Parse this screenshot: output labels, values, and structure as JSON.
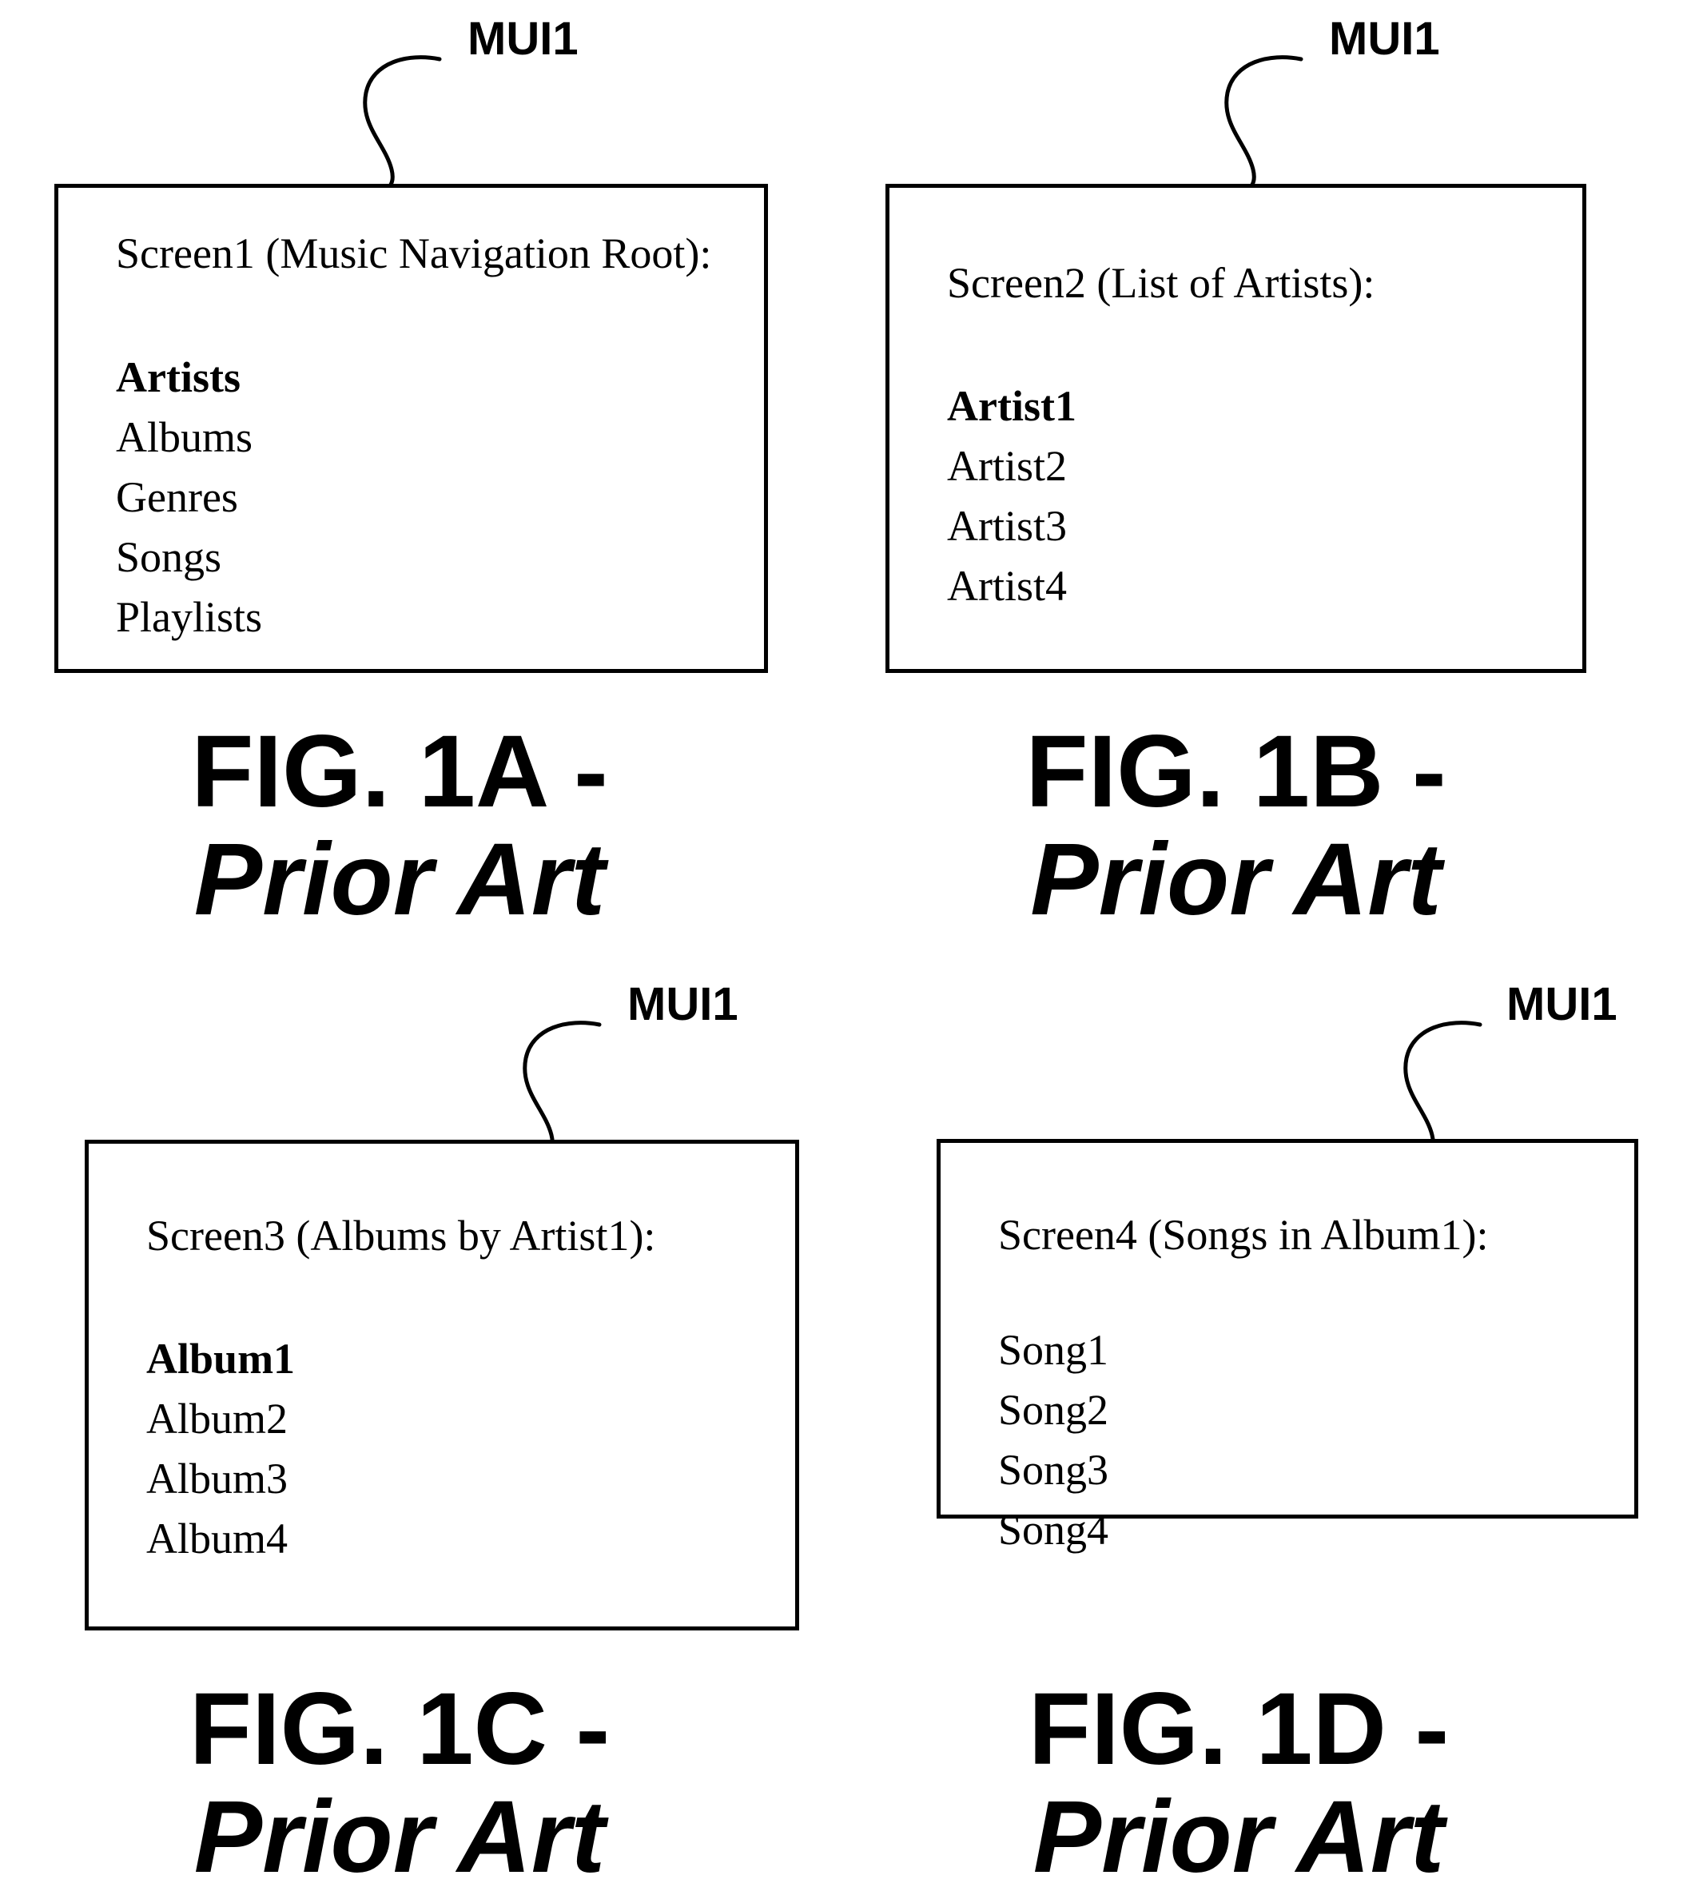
{
  "document": {
    "kind": "patent-drawing-sheet",
    "reference_label": "MUI1"
  },
  "figures": [
    {
      "id": "fig-1a",
      "reference_label": "MUI1",
      "screen_title": "Screen1 (Music Navigation Root):",
      "items": [
        {
          "label": "Artists",
          "bold": true
        },
        {
          "label": "Albums",
          "bold": false
        },
        {
          "label": "Genres",
          "bold": false
        },
        {
          "label": "Songs",
          "bold": false
        },
        {
          "label": "Playlists",
          "bold": false
        }
      ],
      "caption_line1": "FIG. 1A -",
      "caption_line2": "Prior Art"
    },
    {
      "id": "fig-1b",
      "reference_label": "MUI1",
      "screen_title": "Screen2 (List of Artists):",
      "items": [
        {
          "label": "Artist1",
          "bold": true
        },
        {
          "label": "Artist2",
          "bold": false
        },
        {
          "label": "Artist3",
          "bold": false
        },
        {
          "label": "Artist4",
          "bold": false
        }
      ],
      "caption_line1": "FIG. 1B -",
      "caption_line2": "Prior Art"
    },
    {
      "id": "fig-1c",
      "reference_label": "MUI1",
      "screen_title": "Screen3 (Albums by Artist1):",
      "items": [
        {
          "label": "Album1",
          "bold": true
        },
        {
          "label": "Album2",
          "bold": false
        },
        {
          "label": "Album3",
          "bold": false
        },
        {
          "label": "Album4",
          "bold": false
        }
      ],
      "caption_line1": "FIG. 1C -",
      "caption_line2": "Prior Art"
    },
    {
      "id": "fig-1d",
      "reference_label": "MUI1",
      "screen_title": "Screen4 (Songs in Album1):",
      "items": [
        {
          "label": "Song1",
          "bold": false
        },
        {
          "label": "Song2",
          "bold": false
        },
        {
          "label": "Song3",
          "bold": false
        },
        {
          "label": "Song4",
          "bold": false
        }
      ],
      "caption_line1": "FIG. 1D -",
      "caption_line2": "Prior Art"
    }
  ],
  "colors": {
    "ink": "#000000",
    "paper": "#ffffff"
  }
}
